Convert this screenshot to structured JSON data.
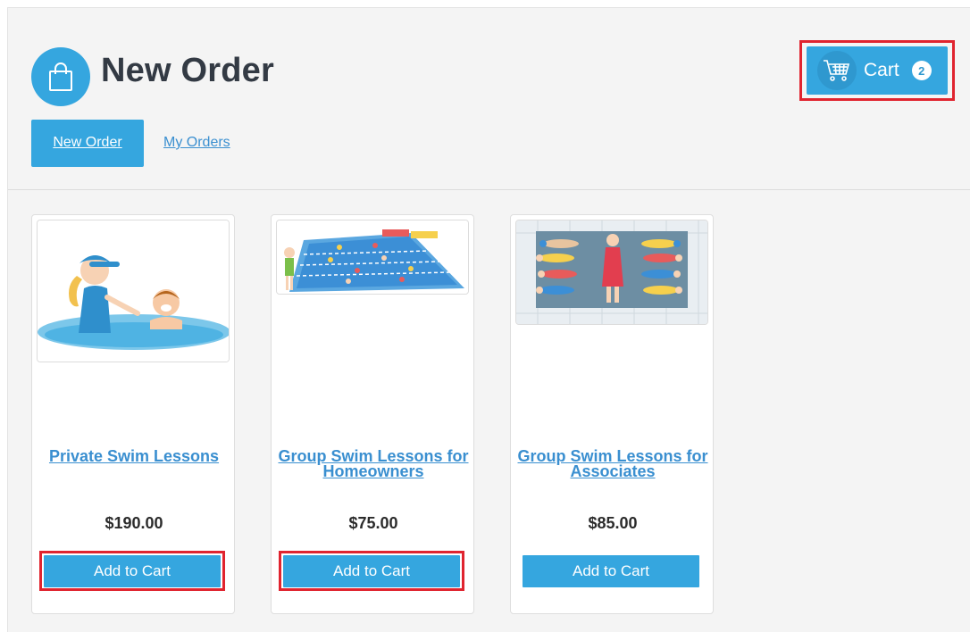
{
  "page": {
    "title": "New Order",
    "title_icon": "shopping-bag-icon"
  },
  "tabs": [
    {
      "label": "New Order",
      "active": true
    },
    {
      "label": "My Orders",
      "active": false
    }
  ],
  "cart": {
    "label": "Cart",
    "count": "2",
    "icon": "shopping-cart-icon"
  },
  "products": [
    {
      "name": "Private Swim Lessons",
      "price": "$190.00",
      "button": "Add to Cart",
      "image": "instructor-and-child-in-pool"
    },
    {
      "name": "Group Swim Lessons for Homeowners",
      "price": "$75.00",
      "button": "Add to Cart",
      "image": "swimmers-in-lane-pool"
    },
    {
      "name": "Group Swim Lessons for Associates",
      "price": "$85.00",
      "button": "Add to Cart",
      "image": "instructor-with-swimmers-in-pool"
    }
  ],
  "colors": {
    "accent": "#35a6df",
    "link": "#3a8fd0",
    "highlight": "#e0242f",
    "background": "#f4f4f4"
  }
}
